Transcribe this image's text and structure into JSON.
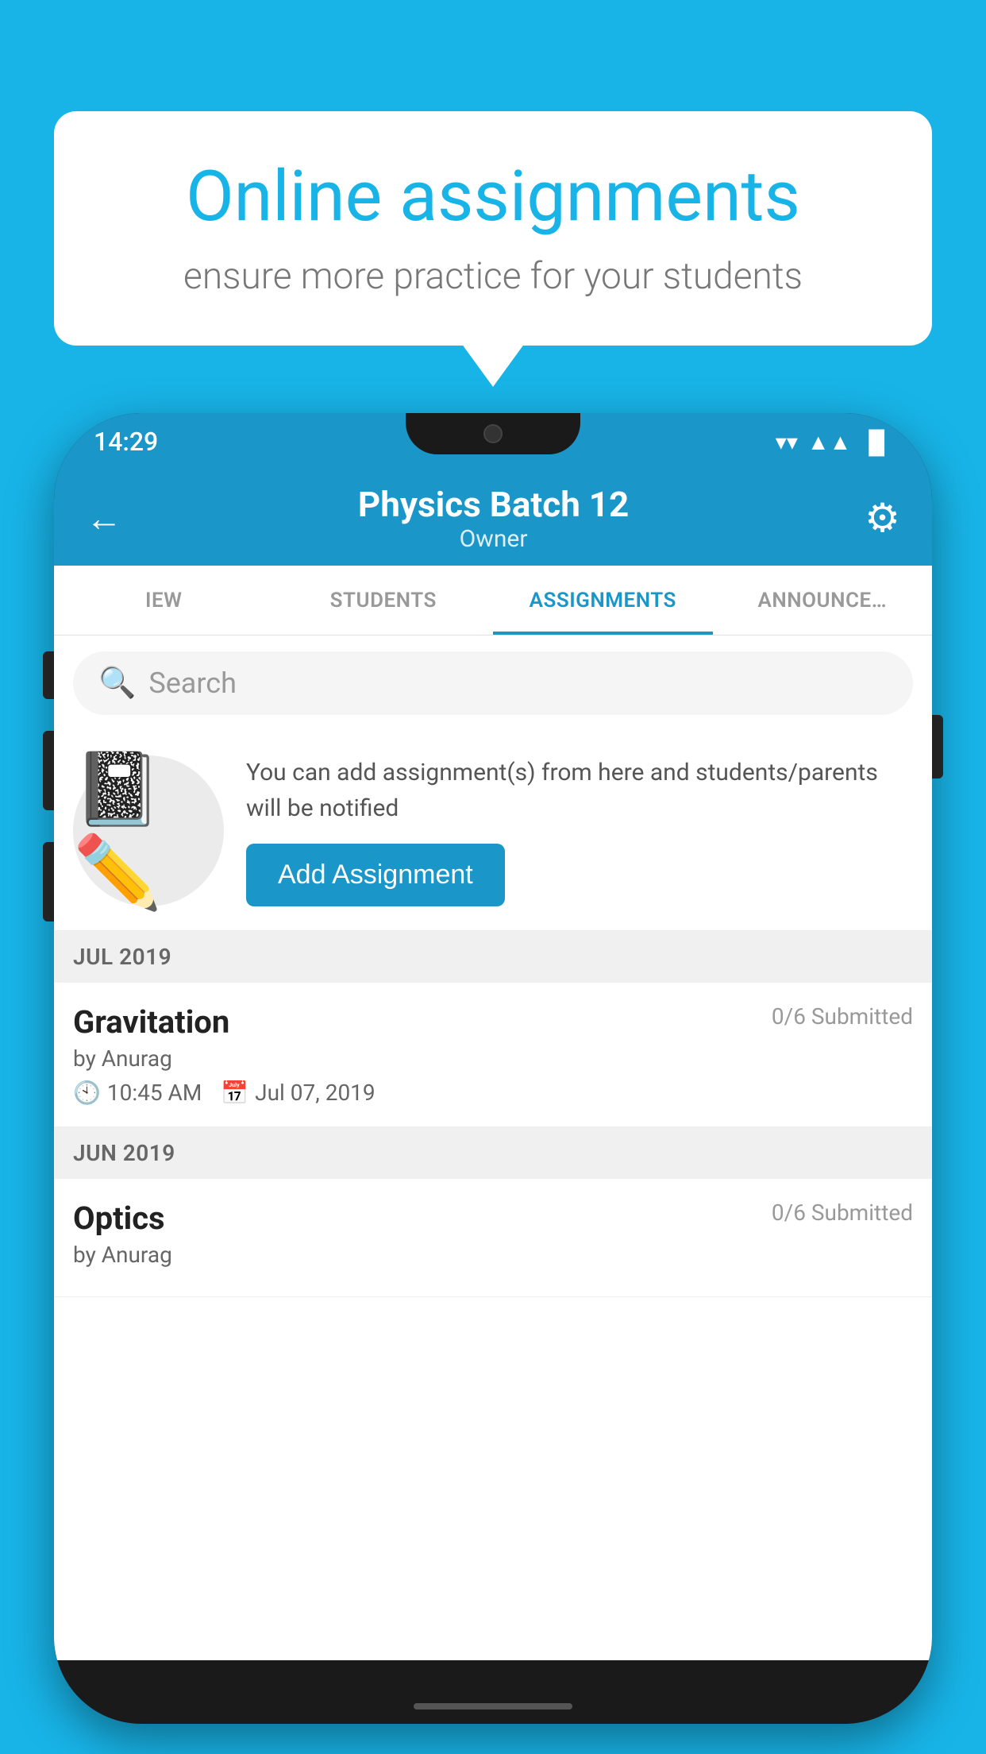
{
  "background": {
    "color": "#18b4e8"
  },
  "speech_bubble": {
    "title": "Online assignments",
    "subtitle": "ensure more practice for your students"
  },
  "phone": {
    "status_bar": {
      "time": "14:29",
      "wifi": "▼",
      "signal": "▲",
      "battery": "▐"
    },
    "header": {
      "title": "Physics Batch 12",
      "subtitle": "Owner",
      "back_label": "←",
      "gear_label": "⚙"
    },
    "tabs": [
      {
        "label": "IEW",
        "active": false
      },
      {
        "label": "STUDENTS",
        "active": false
      },
      {
        "label": "ASSIGNMENTS",
        "active": true
      },
      {
        "label": "ANNOUNCEMENTS",
        "active": false
      }
    ],
    "search": {
      "placeholder": "Search"
    },
    "add_assignment": {
      "description": "You can add assignment(s) from here and students/parents will be notified",
      "button_label": "Add Assignment"
    },
    "assignments": [
      {
        "month_label": "JUL 2019",
        "items": [
          {
            "name": "Gravitation",
            "submitted": "0/6 Submitted",
            "by": "by Anurag",
            "time": "10:45 AM",
            "date": "Jul 07, 2019"
          }
        ]
      },
      {
        "month_label": "JUN 2019",
        "items": [
          {
            "name": "Optics",
            "submitted": "0/6 Submitted",
            "by": "by Anurag",
            "time": "",
            "date": ""
          }
        ]
      }
    ]
  }
}
